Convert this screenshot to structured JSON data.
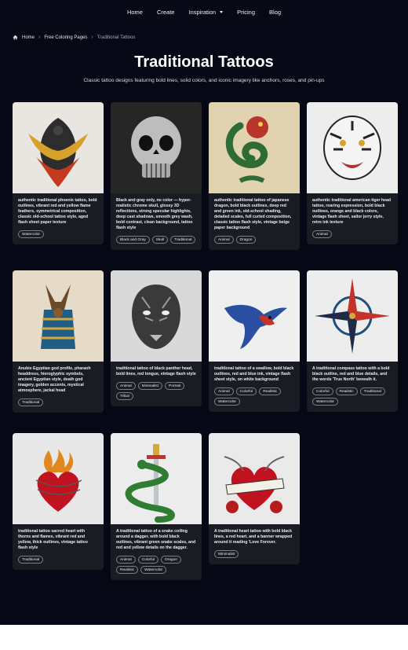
{
  "nav": {
    "items": [
      "Home",
      "Create",
      "Inspiration",
      "Pricing",
      "Blog"
    ]
  },
  "breadcrumb": {
    "home": "Home",
    "section": "Free Coloring Pages",
    "current": "Traditional Tattoos"
  },
  "header": {
    "title": "Traditional Tattoos",
    "subtitle": "Classic tattoo designs featuring bold lines, solid colors, and iconic imagery like anchors, roses, and pin-ups"
  },
  "cards": [
    {
      "desc": "authentic traditional phoenix tattoo, bold outlines, vibrant red and yellow flame feathers, symmetrical composition, classic old-school tattoo style, aged flash sheet paper texture",
      "tags": [
        "Watercolor"
      ],
      "art": "phoenix-art"
    },
    {
      "desc": "Black and gray only, no color — hyper-realistic chrome skull, glossy 3D reflections, strong specular highlights, deep cast shadows, smooth grey wash, bold contrast, clean background, tattoo flash style",
      "tags": [
        "Black and Gray",
        "Skull",
        "Traditional"
      ],
      "art": "skull-art"
    },
    {
      "desc": "authentic traditional tattoo of japanese dragon, bold black outlines, deep red and green ink, old-school shading, detailed scales, full curled composition, classic tattoo flash style, vintage beige paper background",
      "tags": [
        "Animal",
        "Dragon"
      ],
      "art": "dragon-art"
    },
    {
      "desc": "authentic traditional american tiger head tattoo, roaring expression, bold black outlines, orange and black colors, vintage flash sheet, sailor jerry style, retro ink texture",
      "tags": [
        "Animal"
      ],
      "art": "tiger-art"
    },
    {
      "desc": "Anubis Egyptian god profile, pharaoh headdress, hieroglyphic symbols, ancient Egyptian style, death god imagery, golden accents, mystical atmosphere, jackal head",
      "tags": [
        "Traditional"
      ],
      "art": "anubis-art"
    },
    {
      "desc": "traditional tattoo of black panther head, bold lines, red tongue, vintage flash style",
      "tags": [
        "Animal",
        "Minimalist",
        "Portrait",
        "Tribal"
      ],
      "art": "panther-art"
    },
    {
      "desc": "traditional tattoo of a swallow, bold black outlines, red and blue ink, vintage flash sheet style, on white background",
      "tags": [
        "Animal",
        "Colorful",
        "Realistic",
        "Watercolor"
      ],
      "art": "swallow-art"
    },
    {
      "desc": "A traditional compass tattoo with a bold black outline, red and blue details, and the words 'True North' beneath it.",
      "tags": [
        "Colorful",
        "Realistic",
        "Traditional",
        "Watercolor"
      ],
      "art": "compass-art"
    },
    {
      "desc": "traditional tattoo sacred heart with thorns and flames, vibrant red and yellow, thick outlines, vintage tattoo flash style",
      "tags": [
        "Traditional"
      ],
      "art": "sacred-heart-art"
    },
    {
      "desc": "A traditional tattoo of a snake coiling around a dagger, with bold black outlines, vibrant green snake scales, and red and yellow details on the dagger.",
      "tags": [
        "Animal",
        "Colorful",
        "Dragon",
        "Realistic",
        "Watercolor"
      ],
      "art": "snake-dagger-art"
    },
    {
      "desc": "A traditional heart tattoo with bold black lines, a red heart, and a banner wrapped around it reading 'Love Forever.",
      "tags": [
        "Minimalist"
      ],
      "art": "heart-banner-art"
    }
  ],
  "colors": {
    "page_bg": "#060816",
    "card_bg": "#1a1c24",
    "tag_border": "#7b7f8c"
  }
}
